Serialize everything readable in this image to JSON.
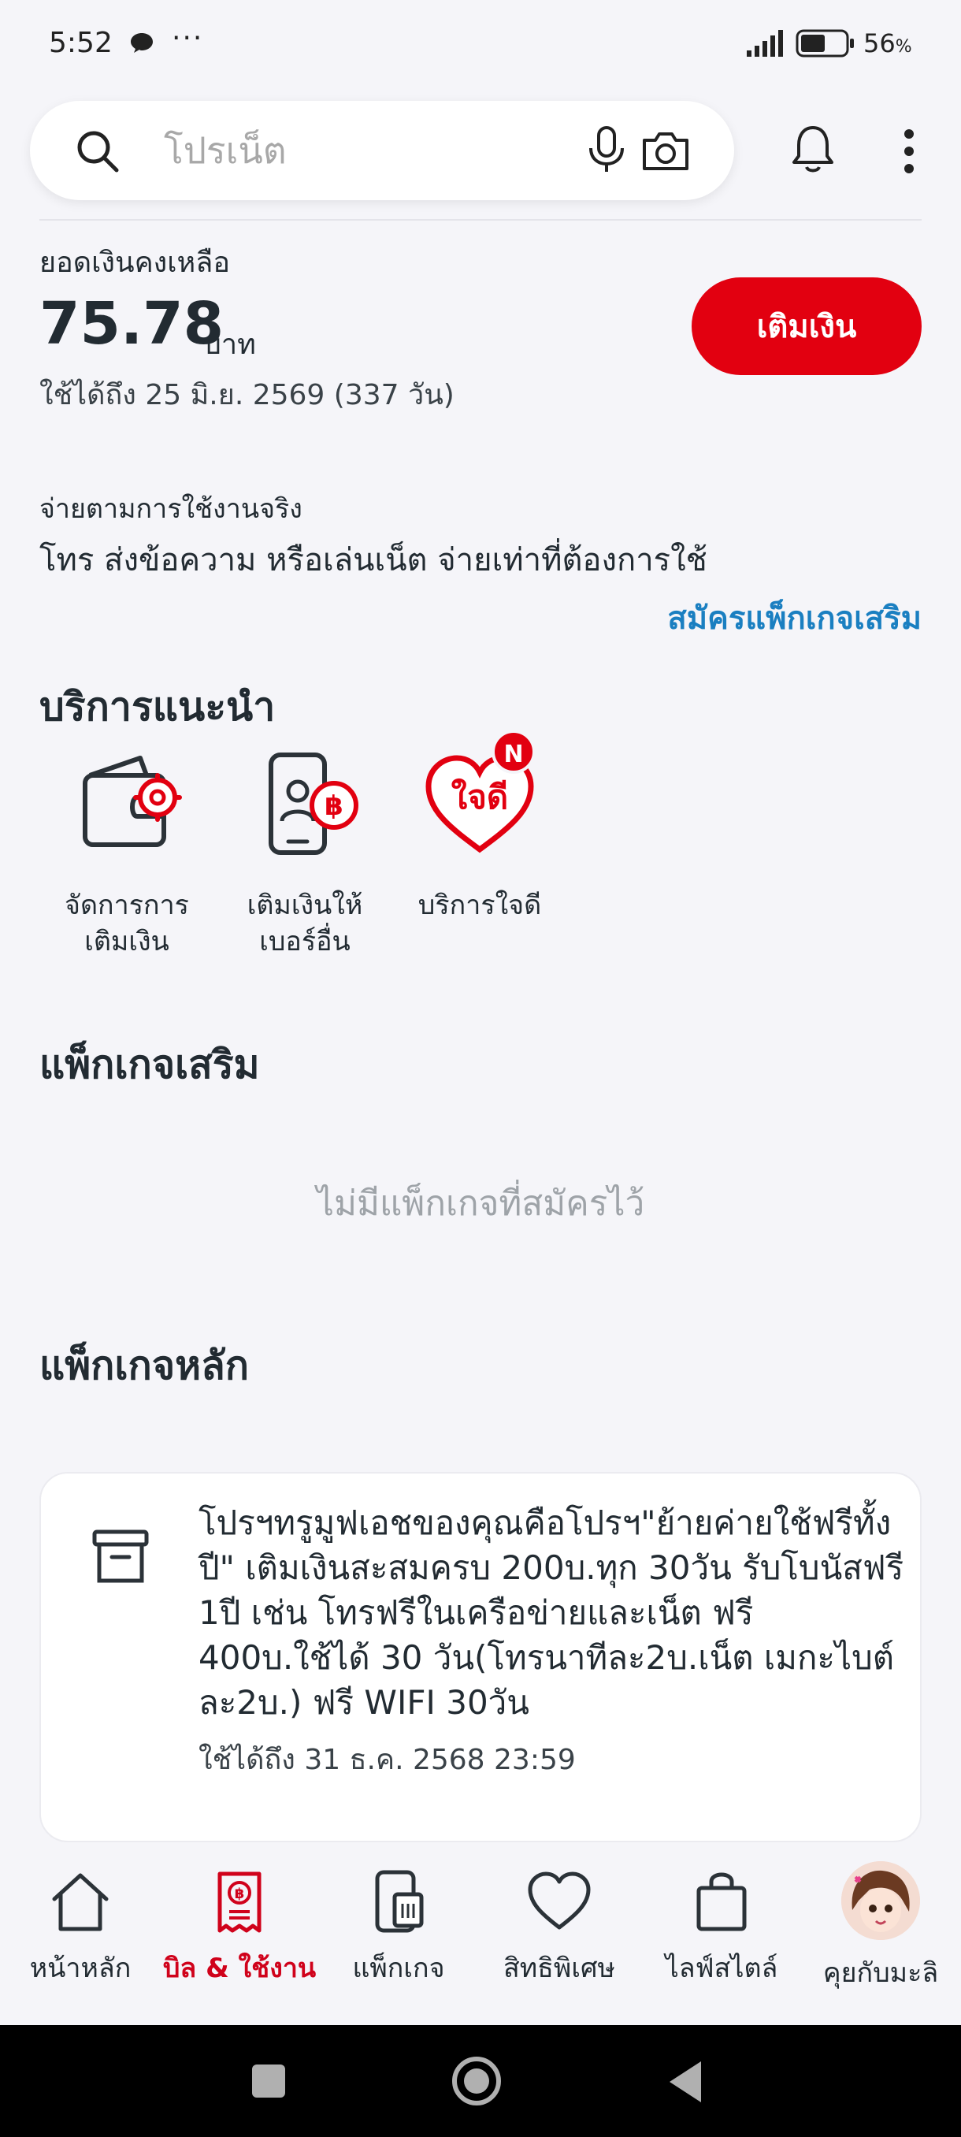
{
  "status_bar": {
    "time": "5:52",
    "more": "···",
    "battery_percent": "56",
    "battery_unit": "%",
    "battery_level": 0.56
  },
  "search": {
    "placeholder": "โปรเน็ต"
  },
  "balance": {
    "label": "ยอดเงินคงเหลือ",
    "amount": "75.78",
    "unit": "บาท",
    "expiry": "ใช้ได้ถึง 25 มิ.ย. 2569 (337 วัน)",
    "topup_button": "เติมเงิน"
  },
  "pay_as_you_go": {
    "title": "จ่ายตามการใช้งานจริง",
    "description": "โทร ส่งข้อความ หรือเล่นเน็ต จ่ายเท่าที่ต้องการใช้",
    "link": "สมัครแพ็กเกจเสริม"
  },
  "recommended": {
    "title": "บริการแนะนำ",
    "items": [
      {
        "label_line1": "จัดการการ",
        "label_line2": "เติมเงิน",
        "icon": "wallet-gear-icon"
      },
      {
        "label_line1": "เติมเงินให้",
        "label_line2": "เบอร์อื่น",
        "icon": "phone-baht-icon"
      },
      {
        "label_line1": "บริการใจดี",
        "label_line2": "",
        "icon": "jaidee-heart-icon",
        "heart_text": "ใจดี",
        "badge": "N"
      }
    ]
  },
  "addon_packages": {
    "title": "แพ็กเกจเสริม",
    "empty_text": "ไม่มีแพ็กเกจที่สมัครไว้"
  },
  "main_packages": {
    "title": "แพ็กเกจหลัก",
    "card": {
      "description": "โปรฯทรูมูฟเอชของคุณคือโปรฯ\"ย้ายค่ายใช้ฟรีทั้งปี\" เติมเงินสะสมครบ 200บ.ทุก 30วัน รับโบนัสฟรี 1ปี เช่น โทรฟรีในเครือข่ายและเน็ต ฟรี 400บ.ใช้ได้ 30 วัน(โทรนาทีละ2บ.เน็ต เมกะไบต์ละ2บ.) ฟรี WIFI 30วัน",
      "expiry": "ใช้ได้ถึง 31 ธ.ค. 2568 23:59",
      "icon": "archive-box-icon"
    }
  },
  "bottom_nav": {
    "items": [
      {
        "label": "หน้าหลัก",
        "icon": "home-icon",
        "active": false
      },
      {
        "label": "บิล & ใช้งาน",
        "icon": "bill-icon",
        "active": true
      },
      {
        "label": "แพ็กเกจ",
        "icon": "sim-phone-icon",
        "active": false
      },
      {
        "label": "สิทธิพิเศษ",
        "icon": "heart-icon",
        "active": false
      },
      {
        "label": "ไลฟ์สไตล์",
        "icon": "shopping-bag-icon",
        "active": false
      },
      {
        "label": "คุยกับมะลิ",
        "icon": "avatar",
        "active": false
      }
    ]
  },
  "colors": {
    "accent_red": "#e20010",
    "link_blue": "#1a7fc1",
    "text_dark": "#222b32",
    "background": "#f5f5f9"
  }
}
